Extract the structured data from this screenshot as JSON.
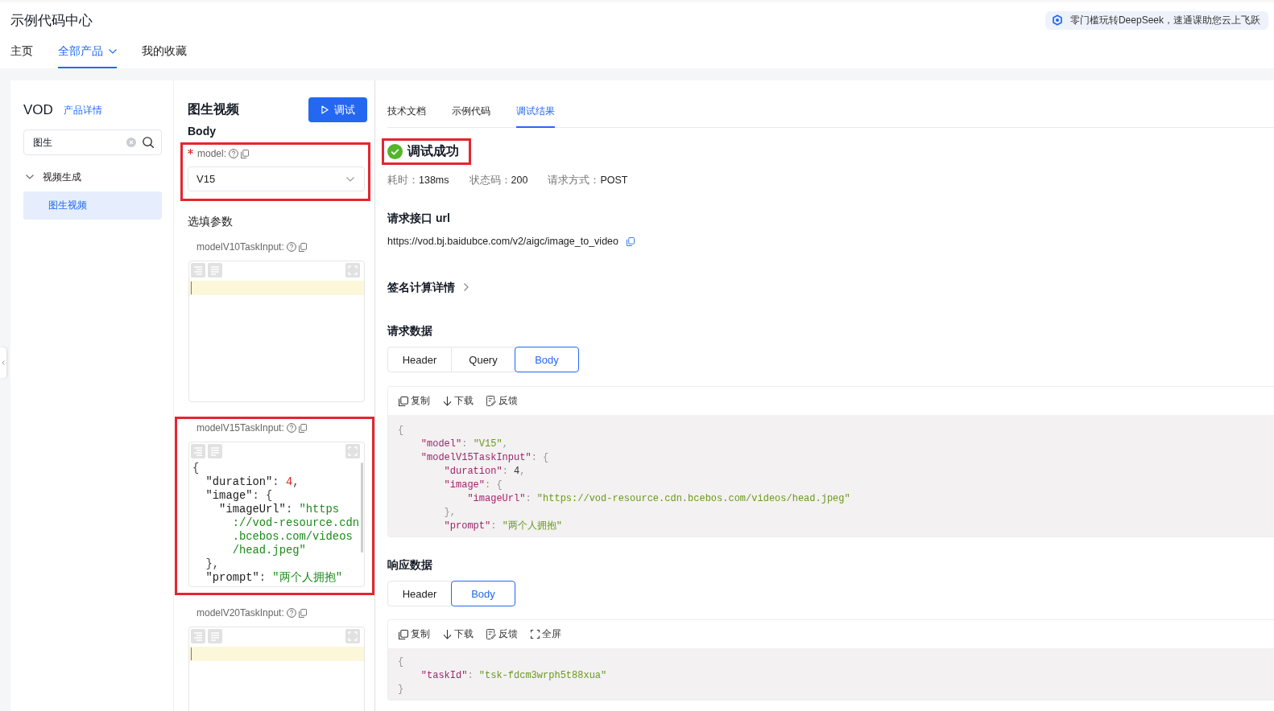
{
  "header": {
    "title": "示例代码中心",
    "banner": {
      "text": "零门槛玩转DeepSeek，速通课助您云上飞跃"
    },
    "nav": [
      {
        "label": "主页",
        "selected": false,
        "dropdown": false
      },
      {
        "label": "全部产品",
        "selected": true,
        "dropdown": true
      },
      {
        "label": "我的收藏",
        "selected": false,
        "dropdown": false
      }
    ]
  },
  "sidebar": {
    "product": "VOD",
    "detail_link": "产品详情",
    "search": {
      "value": "图生"
    },
    "tree": [
      {
        "label": "视频生成",
        "expanded": true,
        "selected": false,
        "children": [
          {
            "label": "图生视频",
            "selected": true
          }
        ]
      }
    ]
  },
  "form": {
    "title": "图生视频",
    "run_button": "调试",
    "body_label": "Body",
    "required_fields": [
      {
        "kind": "select",
        "label": "model:",
        "required": true,
        "value": "V15",
        "highlighted": true
      }
    ],
    "optional_heading": "选填参数",
    "optional_fields": [
      {
        "kind": "json",
        "label": "modelV10TaskInput:",
        "required": false,
        "highlighted": false
      },
      {
        "kind": "json",
        "label": "modelV15TaskInput:",
        "required": false,
        "highlighted": true,
        "lines": [
          "{",
          "  \"duration\": 4,",
          "  \"image\": {",
          "    \"imageUrl\": \"https",
          "      ://vod-resource.cdn",
          "      .bcebos.com/videos",
          "      /head.jpeg\"",
          "  },",
          "  \"prompt\": \"两个人拥抱\""
        ]
      },
      {
        "kind": "json",
        "label": "modelV20TaskInput:",
        "required": false,
        "highlighted": false
      }
    ]
  },
  "result_panel": {
    "tabs": [
      {
        "label": "技术文档",
        "selected": false
      },
      {
        "label": "示例代码",
        "selected": false
      },
      {
        "label": "调试结果",
        "selected": true
      }
    ],
    "status": {
      "kind": "success",
      "text": "调试成功",
      "highlighted": true
    },
    "meta": [
      {
        "label": "耗时：",
        "value": "138ms"
      },
      {
        "label": "状态码：",
        "value": "200"
      },
      {
        "label": "请求方式：",
        "value": "POST"
      }
    ],
    "url_section": {
      "heading": "请求接口 url",
      "url": "https://vod.bj.baidubce.com/v2/aigc/image_to_video"
    },
    "signature": {
      "label": "签名计算详情",
      "expanded": false
    },
    "request": {
      "heading": "请求数据",
      "tabs": [
        {
          "label": "Header",
          "selected": false
        },
        {
          "label": "Query",
          "selected": false
        },
        {
          "label": "Body",
          "selected": true
        }
      ],
      "actions": [
        {
          "kind": "copy",
          "label": "复制"
        },
        {
          "kind": "download",
          "label": "下载"
        },
        {
          "kind": "feedback",
          "label": "反馈"
        }
      ],
      "code": [
        "{",
        "    \"model\": \"V15\",",
        "    \"modelV15TaskInput\": {",
        "        \"duration\": 4,",
        "        \"image\": {",
        "            \"imageUrl\": \"https://vod-resource.cdn.bcebos.com/videos/head.jpeg\"",
        "        },",
        "        \"prompt\": \"两个人拥抱\""
      ]
    },
    "response": {
      "heading": "响应数据",
      "tabs": [
        {
          "label": "Header",
          "selected": false
        },
        {
          "label": "Body",
          "selected": true
        }
      ],
      "actions": [
        {
          "kind": "copy",
          "label": "复制"
        },
        {
          "kind": "download",
          "label": "下载"
        },
        {
          "kind": "feedback",
          "label": "反馈"
        },
        {
          "kind": "fullscreen",
          "label": "全屏"
        }
      ],
      "code": [
        "{",
        "    \"taskId\": \"tsk-fdcm3wrph5t88xua\"",
        "}"
      ]
    }
  }
}
